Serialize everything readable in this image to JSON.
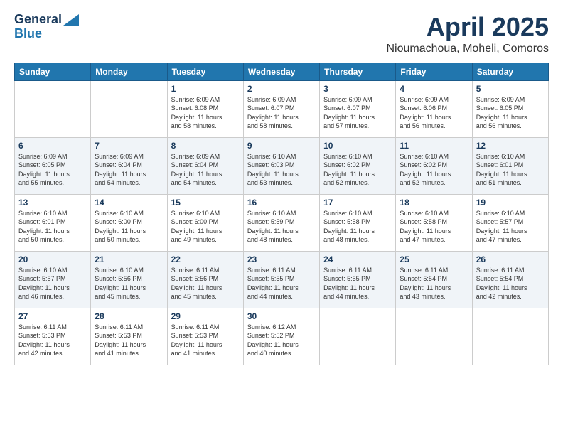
{
  "header": {
    "logo_line1": "General",
    "logo_line2": "Blue",
    "month": "April 2025",
    "location": "Nioumachoua, Moheli, Comoros"
  },
  "weekdays": [
    "Sunday",
    "Monday",
    "Tuesday",
    "Wednesday",
    "Thursday",
    "Friday",
    "Saturday"
  ],
  "weeks": [
    [
      {
        "day": "",
        "info": ""
      },
      {
        "day": "",
        "info": ""
      },
      {
        "day": "1",
        "info": "Sunrise: 6:09 AM\nSunset: 6:08 PM\nDaylight: 11 hours\nand 58 minutes."
      },
      {
        "day": "2",
        "info": "Sunrise: 6:09 AM\nSunset: 6:07 PM\nDaylight: 11 hours\nand 58 minutes."
      },
      {
        "day": "3",
        "info": "Sunrise: 6:09 AM\nSunset: 6:07 PM\nDaylight: 11 hours\nand 57 minutes."
      },
      {
        "day": "4",
        "info": "Sunrise: 6:09 AM\nSunset: 6:06 PM\nDaylight: 11 hours\nand 56 minutes."
      },
      {
        "day": "5",
        "info": "Sunrise: 6:09 AM\nSunset: 6:05 PM\nDaylight: 11 hours\nand 56 minutes."
      }
    ],
    [
      {
        "day": "6",
        "info": "Sunrise: 6:09 AM\nSunset: 6:05 PM\nDaylight: 11 hours\nand 55 minutes."
      },
      {
        "day": "7",
        "info": "Sunrise: 6:09 AM\nSunset: 6:04 PM\nDaylight: 11 hours\nand 54 minutes."
      },
      {
        "day": "8",
        "info": "Sunrise: 6:09 AM\nSunset: 6:04 PM\nDaylight: 11 hours\nand 54 minutes."
      },
      {
        "day": "9",
        "info": "Sunrise: 6:10 AM\nSunset: 6:03 PM\nDaylight: 11 hours\nand 53 minutes."
      },
      {
        "day": "10",
        "info": "Sunrise: 6:10 AM\nSunset: 6:02 PM\nDaylight: 11 hours\nand 52 minutes."
      },
      {
        "day": "11",
        "info": "Sunrise: 6:10 AM\nSunset: 6:02 PM\nDaylight: 11 hours\nand 52 minutes."
      },
      {
        "day": "12",
        "info": "Sunrise: 6:10 AM\nSunset: 6:01 PM\nDaylight: 11 hours\nand 51 minutes."
      }
    ],
    [
      {
        "day": "13",
        "info": "Sunrise: 6:10 AM\nSunset: 6:01 PM\nDaylight: 11 hours\nand 50 minutes."
      },
      {
        "day": "14",
        "info": "Sunrise: 6:10 AM\nSunset: 6:00 PM\nDaylight: 11 hours\nand 50 minutes."
      },
      {
        "day": "15",
        "info": "Sunrise: 6:10 AM\nSunset: 6:00 PM\nDaylight: 11 hours\nand 49 minutes."
      },
      {
        "day": "16",
        "info": "Sunrise: 6:10 AM\nSunset: 5:59 PM\nDaylight: 11 hours\nand 48 minutes."
      },
      {
        "day": "17",
        "info": "Sunrise: 6:10 AM\nSunset: 5:58 PM\nDaylight: 11 hours\nand 48 minutes."
      },
      {
        "day": "18",
        "info": "Sunrise: 6:10 AM\nSunset: 5:58 PM\nDaylight: 11 hours\nand 47 minutes."
      },
      {
        "day": "19",
        "info": "Sunrise: 6:10 AM\nSunset: 5:57 PM\nDaylight: 11 hours\nand 47 minutes."
      }
    ],
    [
      {
        "day": "20",
        "info": "Sunrise: 6:10 AM\nSunset: 5:57 PM\nDaylight: 11 hours\nand 46 minutes."
      },
      {
        "day": "21",
        "info": "Sunrise: 6:10 AM\nSunset: 5:56 PM\nDaylight: 11 hours\nand 45 minutes."
      },
      {
        "day": "22",
        "info": "Sunrise: 6:11 AM\nSunset: 5:56 PM\nDaylight: 11 hours\nand 45 minutes."
      },
      {
        "day": "23",
        "info": "Sunrise: 6:11 AM\nSunset: 5:55 PM\nDaylight: 11 hours\nand 44 minutes."
      },
      {
        "day": "24",
        "info": "Sunrise: 6:11 AM\nSunset: 5:55 PM\nDaylight: 11 hours\nand 44 minutes."
      },
      {
        "day": "25",
        "info": "Sunrise: 6:11 AM\nSunset: 5:54 PM\nDaylight: 11 hours\nand 43 minutes."
      },
      {
        "day": "26",
        "info": "Sunrise: 6:11 AM\nSunset: 5:54 PM\nDaylight: 11 hours\nand 42 minutes."
      }
    ],
    [
      {
        "day": "27",
        "info": "Sunrise: 6:11 AM\nSunset: 5:53 PM\nDaylight: 11 hours\nand 42 minutes."
      },
      {
        "day": "28",
        "info": "Sunrise: 6:11 AM\nSunset: 5:53 PM\nDaylight: 11 hours\nand 41 minutes."
      },
      {
        "day": "29",
        "info": "Sunrise: 6:11 AM\nSunset: 5:53 PM\nDaylight: 11 hours\nand 41 minutes."
      },
      {
        "day": "30",
        "info": "Sunrise: 6:12 AM\nSunset: 5:52 PM\nDaylight: 11 hours\nand 40 minutes."
      },
      {
        "day": "",
        "info": ""
      },
      {
        "day": "",
        "info": ""
      },
      {
        "day": "",
        "info": ""
      }
    ]
  ]
}
